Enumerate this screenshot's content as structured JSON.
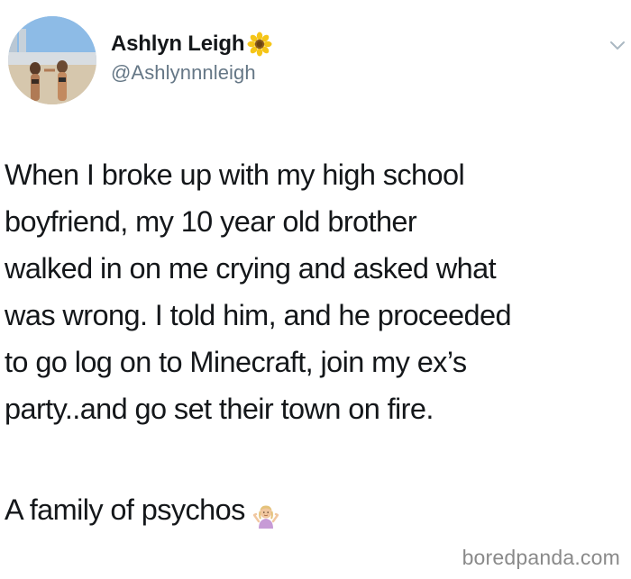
{
  "author": {
    "display_name": "Ashlyn Leigh",
    "handle": "@Ashlynnnleigh",
    "badge_icon": "sunflower-icon"
  },
  "tweet": {
    "lines": [
      "When I broke up with my high school",
      "boyfriend, my 10 year old brother",
      "walked in on me crying and asked what",
      "was wrong. I told him, and he proceeded",
      "to go log on to Minecraft, join my ex’s",
      "party..and go set their town on fire."
    ],
    "second_paragraph": "A family of psychos",
    "emoji_icon": "person-shrugging-icon"
  },
  "menu_icon": "chevron-down-icon",
  "watermark": "boredpanda.com",
  "colors": {
    "text": "#14171a",
    "secondary": "#657786",
    "watermark": "#8a8a8a",
    "background": "#ffffff"
  }
}
